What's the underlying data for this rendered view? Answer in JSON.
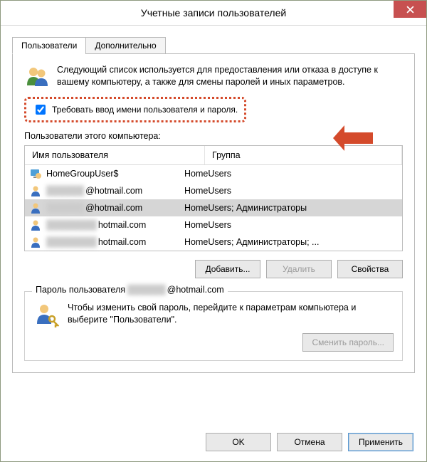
{
  "title": "Учетные записи пользователей",
  "tabs": {
    "users": "Пользователи",
    "advanced": "Дополнительно"
  },
  "intro": "Следующий список используется для предоставления или отказа в доступе к вашему компьютеру, а также для смены паролей и иных параметров.",
  "require_login": "Требовать ввод имени пользователя и пароля.",
  "list_label": "Пользователи этого компьютера:",
  "cols": {
    "name": "Имя пользователя",
    "group": "Группа"
  },
  "rows": [
    {
      "name": "HomeGroupUser$",
      "group": "HomeUsers",
      "blurred": false
    },
    {
      "name": "██████",
      "suffix": "@hotmail.com",
      "group": "HomeUsers",
      "blurred": true
    },
    {
      "name": "██████",
      "suffix": "@hotmail.com",
      "group": "HomeUsers; Администраторы",
      "blurred": true,
      "selected": true
    },
    {
      "name": "████████",
      "suffix": "hotmail.com",
      "group": "HomeUsers",
      "blurred": true
    },
    {
      "name": "████████",
      "suffix": "hotmail.com",
      "group": "HomeUsers; Администраторы; ...",
      "blurred": true
    }
  ],
  "buttons": {
    "add": "Добавить...",
    "remove": "Удалить",
    "props": "Свойства"
  },
  "pw_group_prefix": "Пароль пользователя ",
  "pw_group_suffix": "@hotmail.com",
  "pw_text": "Чтобы изменить свой пароль, перейдите к параметрам компьютера и выберите \"Пользователи\".",
  "pw_btn": "Сменить пароль...",
  "footer": {
    "ok": "OK",
    "cancel": "Отмена",
    "apply": "Применить"
  }
}
